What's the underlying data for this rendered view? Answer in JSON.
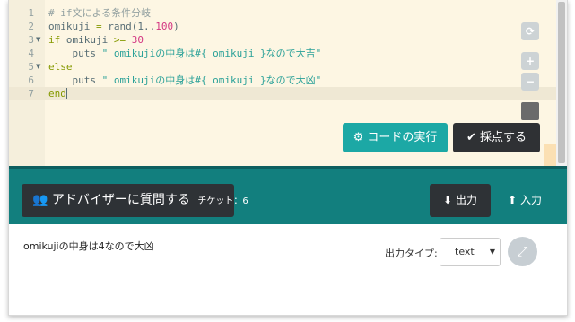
{
  "editor": {
    "lines": [
      {
        "num": "1",
        "fold": ""
      },
      {
        "num": "2",
        "fold": ""
      },
      {
        "num": "3",
        "fold": "▼"
      },
      {
        "num": "4",
        "fold": ""
      },
      {
        "num": "5",
        "fold": "▼"
      },
      {
        "num": "6",
        "fold": ""
      },
      {
        "num": "7",
        "fold": ""
      }
    ],
    "code": {
      "l1_comment": "# if文による条件分岐",
      "l2_var": "omikuji",
      "l2_eq": " = ",
      "l2_rand": "rand(1..",
      "l2_num": "100",
      "l2_close": ")",
      "l3_kw": "if",
      "l3_var": " omikuji ",
      "l3_op": ">=",
      "l3_num": " 30",
      "l4_puts": "    puts ",
      "l4_str": "\" omikujiの中身は#{ omikuji }なので大吉\"",
      "l5_kw": "else",
      "l6_puts": "    puts ",
      "l6_str": "\" omikujiの中身は#{ omikuji }なので大凶\"",
      "l7_kw": "end"
    },
    "tools": {
      "refresh_icon": "⟳",
      "zoom_in_icon": "+",
      "zoom_out_icon": "−"
    }
  },
  "actions": {
    "run_label": "コードの実行",
    "run_icon": "⚙",
    "score_label": "採点する",
    "score_icon": "✔"
  },
  "toolbar": {
    "advisor_icon": "👥",
    "advisor_label": "アドバイザーに質問する",
    "tickets": "チケット：6",
    "output_icon": "⬇",
    "output_label": "出力",
    "input_icon": "⬆",
    "input_label": "入力"
  },
  "output": {
    "text": "omikujiの中身は4なので大凶",
    "type_label": "出力タイプ:",
    "type_value": "text",
    "expand_icon": "⤢"
  },
  "colors": {
    "teal": "#127f7e",
    "run_button": "#1ca8a5",
    "dark_button": "#2e3236",
    "editor_bg": "#fdf6e3"
  }
}
